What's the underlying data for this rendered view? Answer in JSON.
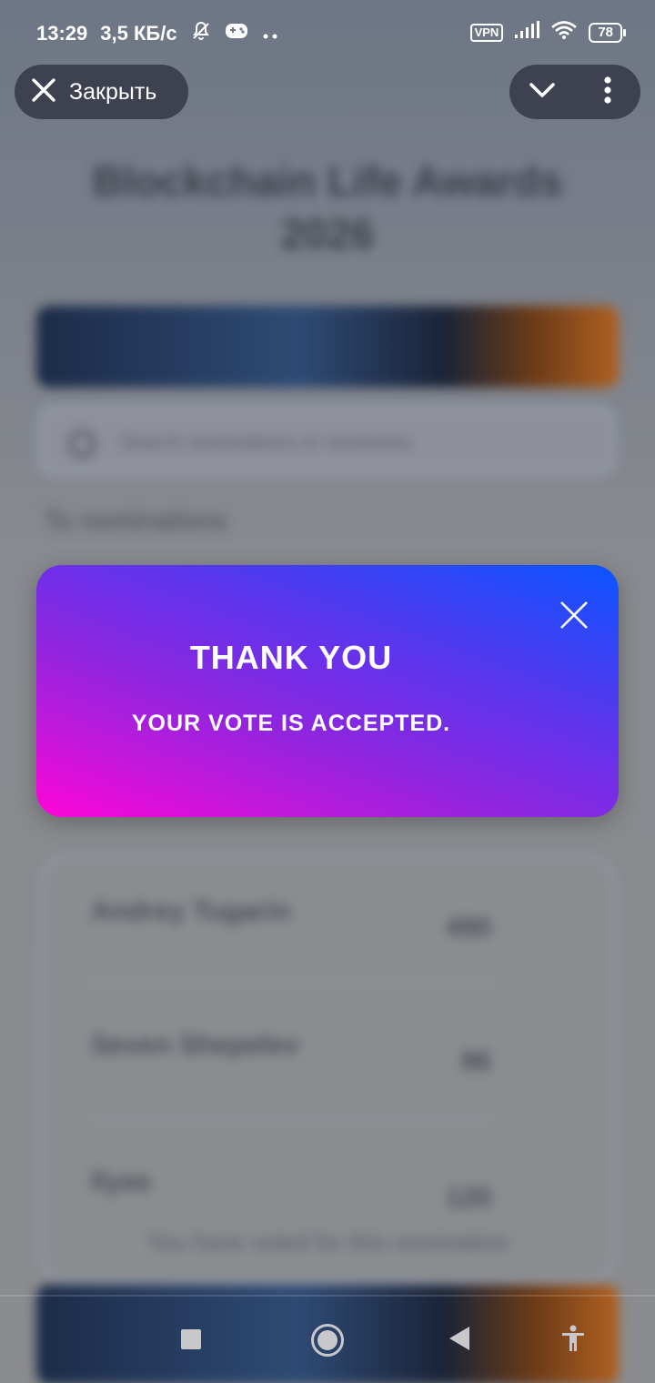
{
  "status_bar": {
    "time": "13:29",
    "speed": "3,5 КБ/с",
    "vpn": "VPN",
    "battery": "78"
  },
  "top_bar": {
    "close_label": "Закрыть"
  },
  "modal": {
    "title": "THANK YOU",
    "subtitle": "YOUR VOTE IS ACCEPTED."
  },
  "background": {
    "title": "Blockchain Life Awards 2026",
    "search_placeholder": "Search nominations or nominees",
    "back_link": "To nominations",
    "rows": [
      {
        "name": "Andrey Tugarin",
        "value": "490"
      },
      {
        "name": "Seven Shepelev",
        "value": "96"
      },
      {
        "name": "Ilyas",
        "value": "120"
      }
    ],
    "footer": "You have voted for this nomination"
  },
  "colors": {
    "modal_gradient_start": "#0a55ff",
    "modal_gradient_end": "#ff05d6",
    "pill_background": "#3d4150"
  }
}
